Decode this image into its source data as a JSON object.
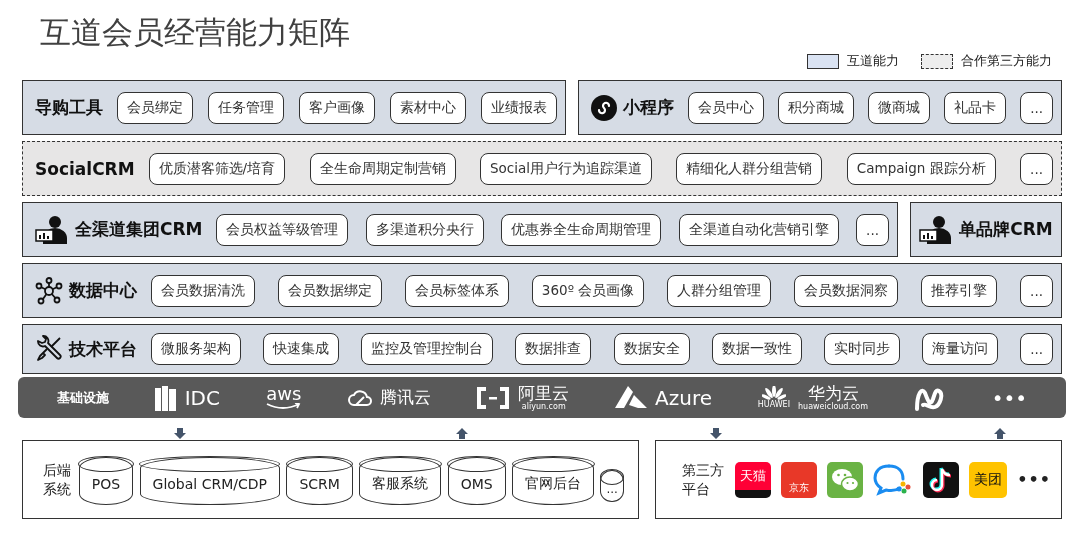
{
  "title": "互道会员经营能力矩阵",
  "legend": [
    {
      "kind": "own",
      "label": "互道能力"
    },
    {
      "kind": "partner",
      "label": "合作第三方能力"
    }
  ],
  "layers": [
    {
      "panels": [
        {
          "partner": false,
          "kind": "plain",
          "title": "导购工具",
          "items": [
            "会员绑定",
            "任务管理",
            "客户画像",
            "素材中心",
            "业绩报表"
          ]
        },
        {
          "partner": false,
          "kind": "miniapp",
          "title": "小程序",
          "items": [
            "会员中心",
            "积分商城",
            "微商城",
            "礼品卡",
            "..."
          ]
        }
      ]
    },
    {
      "panels": [
        {
          "partner": true,
          "kind": "plain",
          "title": "SocialCRM",
          "items": [
            "优质潜客筛选/培育",
            "全生命周期定制营销",
            "Social用户行为追踪渠道",
            "精细化人群分组营销",
            "Campaign 跟踪分析",
            "..."
          ]
        }
      ]
    },
    {
      "panels": [
        {
          "partner": false,
          "kind": "user",
          "title": "全渠道集团CRM",
          "items": [
            "会员权益等级管理",
            "多渠道积分央行",
            "优惠券全生命周期管理",
            "全渠道自动化营销引擎",
            "..."
          ]
        },
        {
          "partner": false,
          "kind": "user",
          "title": "单品牌CRM"
        }
      ]
    },
    {
      "panels": [
        {
          "partner": false,
          "kind": "network",
          "title": "数据中心",
          "items": [
            "会员数据清洗",
            "会员数据绑定",
            "会员标签体系",
            "360º 会员画像",
            "人群分组管理",
            "会员数据洞察",
            "推荐引擎",
            "..."
          ]
        }
      ]
    },
    {
      "panels": [
        {
          "partner": false,
          "kind": "tools",
          "title": "技术平台",
          "items": [
            "微服务架构",
            "快速集成",
            "监控及管理控制台",
            "数据排查",
            "数据安全",
            "数据一致性",
            "实时同步",
            "海量访问",
            "..."
          ]
        }
      ]
    }
  ],
  "infrastructure": {
    "label": "基础设施",
    "providers": [
      {
        "kind": "server",
        "name": "IDC"
      },
      {
        "kind": "smile",
        "name": "aws"
      },
      {
        "kind": "cloud",
        "name": "腾讯云"
      },
      {
        "kind": "bracket",
        "name": "阿里云",
        "caption": "aliyun.com"
      },
      {
        "kind": "triangle",
        "name": "Azure"
      },
      {
        "kind": "petals",
        "name": "华为云",
        "caption": "huaweicloud.com",
        "mark": "HUAWEI"
      },
      {
        "kind": "ribbon"
      },
      {
        "kind": "more",
        "name": "•••"
      }
    ]
  },
  "backend": {
    "label": "后端系统",
    "systems": [
      {
        "kind": "cylinder",
        "name": "POS"
      },
      {
        "kind": "cylinder",
        "name": "Global CRM/CDP"
      },
      {
        "kind": "cylinder",
        "name": "SCRM"
      },
      {
        "kind": "cylinder",
        "name": "客服系统"
      },
      {
        "kind": "cylinder",
        "name": "OMS"
      },
      {
        "kind": "cylinder",
        "name": "官网后台"
      },
      {
        "kind": "mini",
        "name": "..."
      }
    ]
  },
  "third_party": {
    "label": "第三方平台",
    "apps": [
      {
        "kind": "tmall",
        "label": "天猫"
      },
      {
        "kind": "jd",
        "label": "京东"
      },
      {
        "kind": "wechat"
      },
      {
        "kind": "chat"
      },
      {
        "kind": "tiktok"
      },
      {
        "kind": "meituan",
        "label": "美团"
      },
      {
        "kind": "more",
        "label": "•••"
      }
    ]
  }
}
